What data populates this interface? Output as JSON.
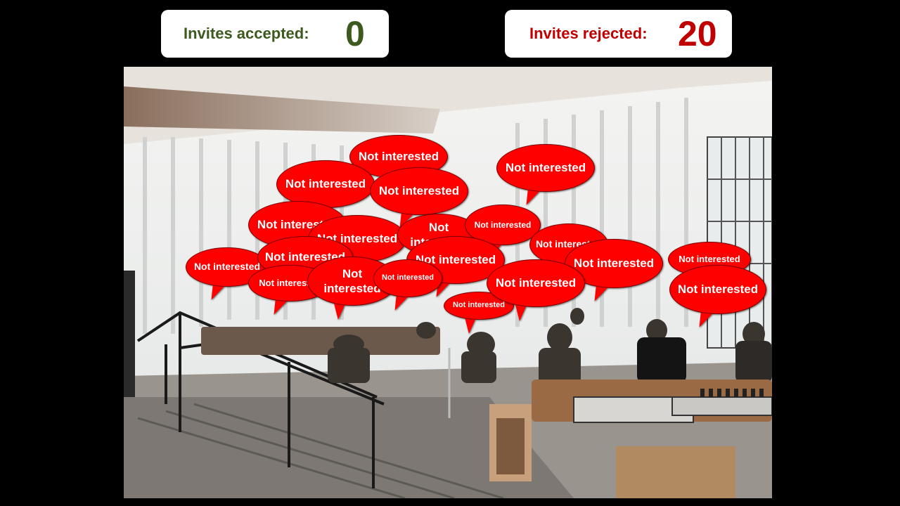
{
  "counters": {
    "accepted": {
      "label": "Invites accepted:",
      "value": "0",
      "color": "#3d5a1e"
    },
    "rejected": {
      "label": "Invites rejected:",
      "value": "20",
      "color": "#c00000"
    }
  },
  "bubble": {
    "text": "Not interested",
    "color": "#ff0000"
  },
  "bubble_count": 20
}
